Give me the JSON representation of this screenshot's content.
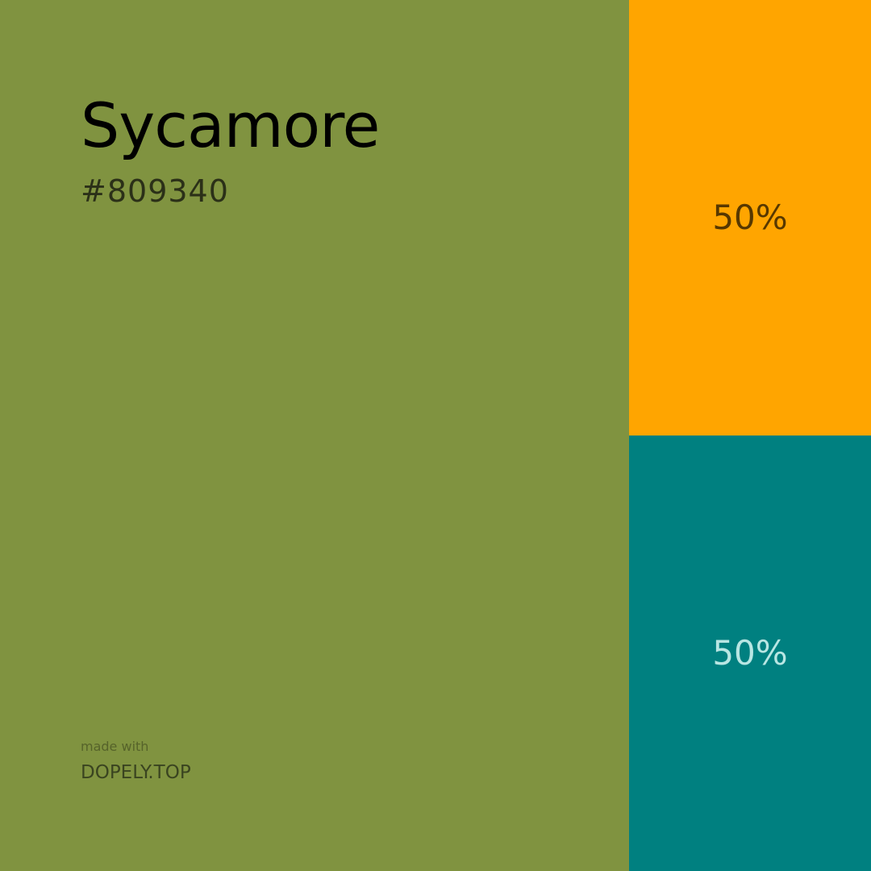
{
  "main": {
    "name": "Sycamore",
    "hex": "#809340",
    "color": "#809340"
  },
  "footer": {
    "made_with": "made with",
    "brand": "DOPELY.TOP"
  },
  "swatches": [
    {
      "percent": "50%",
      "color": "#FFA500"
    },
    {
      "percent": "50%",
      "color": "#008080"
    }
  ]
}
